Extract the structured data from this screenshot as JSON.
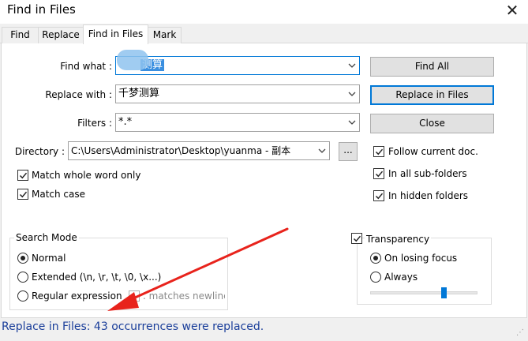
{
  "window": {
    "title": "Find in Files",
    "close_glyph": "✕"
  },
  "tabs": [
    {
      "label": "Find",
      "active": false
    },
    {
      "label": "Replace",
      "active": false
    },
    {
      "label": "Find in Files",
      "active": true
    },
    {
      "label": "Mark",
      "active": false
    }
  ],
  "form": {
    "find_what_label": "Find what :",
    "find_what_value": "测算",
    "replace_with_label": "Replace with :",
    "replace_with_value": "千梦测算",
    "filters_label": "Filters :",
    "filters_value": "*.*",
    "directory_label": "Directory :",
    "directory_value": "C:\\Users\\Administrator\\Desktop\\yuanma - 副本",
    "browse_label": "..."
  },
  "options": {
    "match_whole_word": {
      "label": "Match whole word only",
      "checked": true
    },
    "match_case": {
      "label": "Match case",
      "checked": true
    },
    "follow_current_doc": {
      "label": "Follow current doc.",
      "checked": true
    },
    "in_all_subfolders": {
      "label": "In all sub-folders",
      "checked": true
    },
    "in_hidden_folders": {
      "label": "In hidden folders",
      "checked": true
    }
  },
  "buttons": {
    "find_all": "Find All",
    "replace_in_files": "Replace in Files",
    "close": "Close"
  },
  "search_mode": {
    "title": "Search Mode",
    "normal": "Normal",
    "extended": "Extended (\\n, \\r, \\t, \\0, \\x...)",
    "regex": "Regular expression",
    "matches_newline": ". matches newline",
    "selected": "normal"
  },
  "transparency": {
    "label": "Transparency",
    "checked": true,
    "on_losing_focus": "On losing focus",
    "always": "Always",
    "selected": "on_losing_focus",
    "slider_level": 0.7
  },
  "status": {
    "text": "Replace in Files: 43 occurrences were replaced.",
    "color": "#1a3e9a"
  },
  "colors": {
    "accent": "#0078d7",
    "arrow": "#e8231c"
  },
  "icons": {
    "close": "close-icon",
    "dropdown": "chevron-down-icon",
    "checkbox": "checkmark-icon",
    "annotation": "red-arrow"
  }
}
